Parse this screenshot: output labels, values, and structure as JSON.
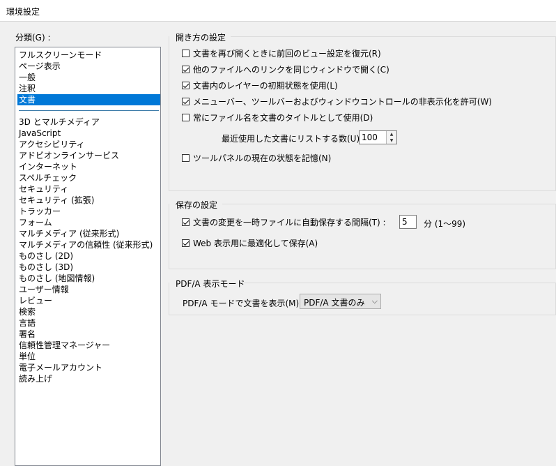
{
  "window": {
    "title": "環境設定"
  },
  "category_label": "分類(G) :",
  "categories": {
    "top": [
      "フルスクリーンモード",
      "ページ表示",
      "一般",
      "注釈",
      "文書"
    ],
    "rest": [
      "3D とマルチメディア",
      "JavaScript",
      "アクセシビリティ",
      "アドビオンラインサービス",
      "インターネット",
      "スペルチェック",
      "セキュリティ",
      "セキュリティ (拡張)",
      "トラッカー",
      "フォーム",
      "マルチメディア (従来形式)",
      "マルチメディアの信頼性 (従来形式)",
      "ものさし (2D)",
      "ものさし (3D)",
      "ものさし (地図情報)",
      "ユーザー情報",
      "レビュー",
      "検索",
      "言語",
      "署名",
      "信頼性管理マネージャー",
      "単位",
      "電子メールアカウント",
      "読み上げ"
    ],
    "selected": "文書"
  },
  "open_settings": {
    "title": "開き方の設定",
    "restore_last_view": {
      "label": "文書を再び開くときに前回のビュー設定を復元(R)",
      "checked": false
    },
    "open_links_same_window": {
      "label": "他のファイルへのリンクを同じウィンドウで開く(C)",
      "checked": true
    },
    "use_initial_layer_state": {
      "label": "文書内のレイヤーの初期状態を使用(L)",
      "checked": true
    },
    "allow_hide_menubar": {
      "label": "メニューバー、ツールバーおよびウィンドウコントロールの非表示化を許可(W)",
      "checked": true
    },
    "filename_as_title": {
      "label": "常にファイル名を文書のタイトルとして使用(D)",
      "checked": false
    },
    "recent_docs_label": "最近使用した文書にリストする数(U) :",
    "recent_docs_value": "100",
    "remember_tool_panel": {
      "label": "ツールパネルの現在の状態を記憶(N)",
      "checked": false
    }
  },
  "save_settings": {
    "title": "保存の設定",
    "autosave": {
      "label": "文書の変更を一時ファイルに自動保存する間隔(T) :",
      "checked": true
    },
    "autosave_value": "5",
    "autosave_unit": "分 (1〜99)",
    "optimize_web": {
      "label": "Web 表示用に最適化して保存(A)",
      "checked": true
    }
  },
  "pdfa": {
    "title": "PDF/A 表示モード",
    "mode_label": "PDF/A モードで文書を表示(M) :",
    "mode_value": "PDF/A 文書のみ"
  },
  "icons": {
    "dropdown": "chevron-down-icon",
    "spin_up": "chevron-up-icon",
    "spin_down": "chevron-down-icon"
  }
}
